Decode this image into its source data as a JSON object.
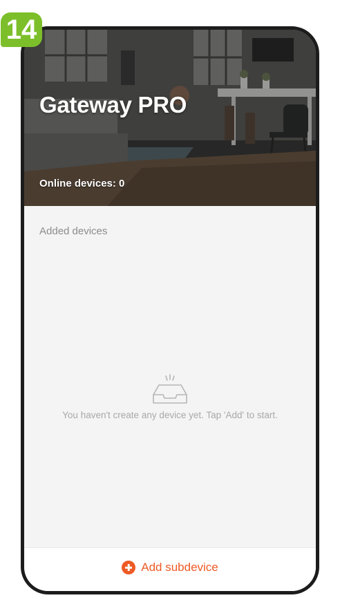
{
  "step_badge": "14",
  "header": {
    "title": "Gateway PRO",
    "online_devices": "Online devices: 0"
  },
  "devices": {
    "section_label": "Added devices",
    "empty_message": "You haven't create any device yet. Tap 'Add' to start."
  },
  "footer": {
    "add_label": "Add subdevice"
  },
  "colors": {
    "accent": "#ee5a24",
    "badge": "#7cbf2a",
    "background": "#f4f4f4"
  },
  "icons": {
    "hero": "room-photo",
    "empty": "empty-inbox-icon",
    "add": "plus-circle-icon"
  }
}
